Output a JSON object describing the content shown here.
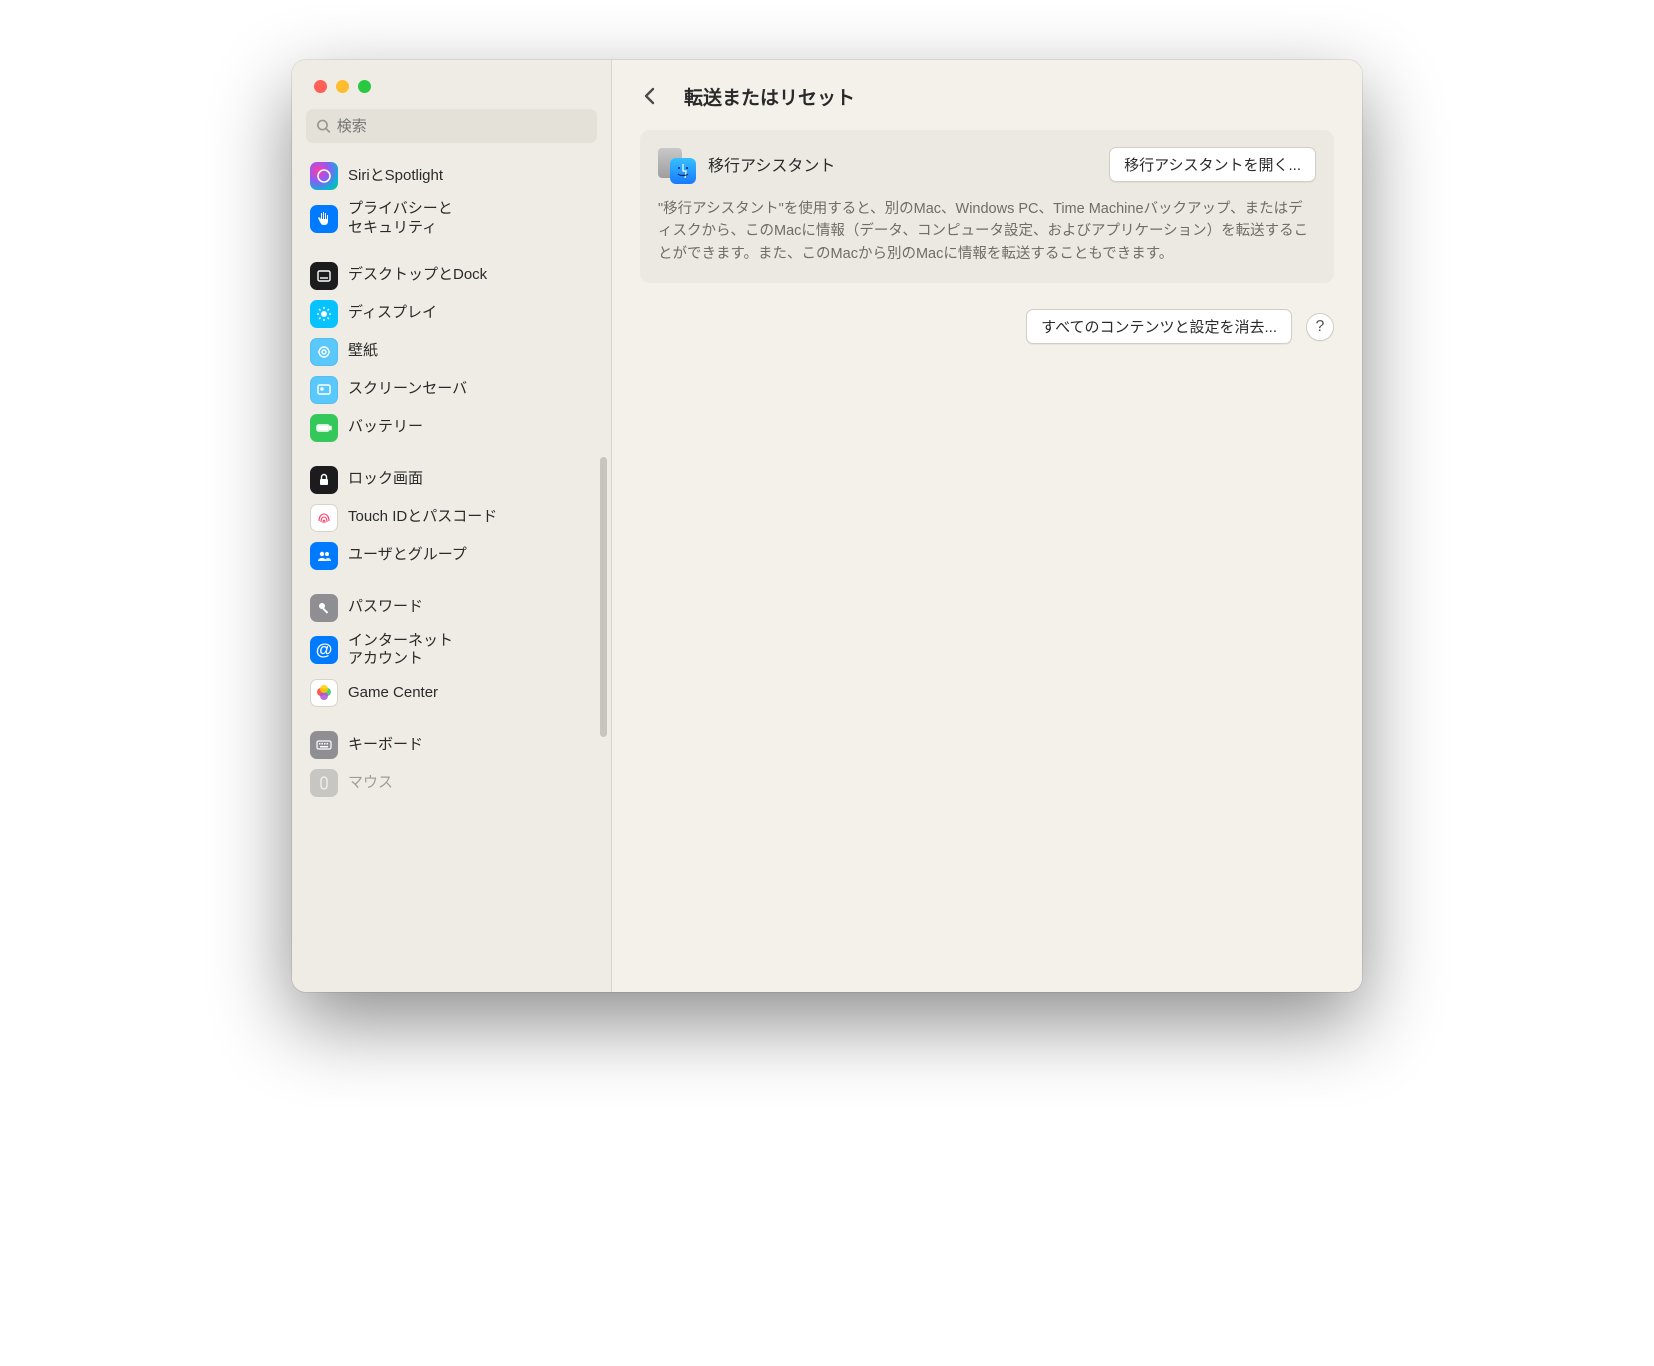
{
  "search": {
    "placeholder": "検索"
  },
  "page": {
    "title": "転送またはリセット",
    "migration": {
      "label": "移行アシスタント",
      "button": "移行アシスタントを開く...",
      "description": "\"移行アシスタント\"を使用すると、別のMac、Windows PC、Time Machineバックアップ、またはディスクから、このMacに情報（データ、コンピュータ設定、およびアプリケーション）を転送することができます。また、このMacから別のMacに情報を転送することもできます。"
    },
    "erase_button": "すべてのコンテンツと設定を消去..."
  },
  "sidebar": {
    "groups": [
      {
        "items": [
          {
            "id": "siri",
            "label": "SiriとSpotlight"
          },
          {
            "id": "privacy",
            "label": "プライバシーと\nセキュリティ"
          }
        ]
      },
      {
        "items": [
          {
            "id": "desktop",
            "label": "デスクトップとDock"
          },
          {
            "id": "display",
            "label": "ディスプレイ"
          },
          {
            "id": "wallpaper",
            "label": "壁紙"
          },
          {
            "id": "screensaver",
            "label": "スクリーンセーバ"
          },
          {
            "id": "battery",
            "label": "バッテリー"
          }
        ]
      },
      {
        "items": [
          {
            "id": "lock",
            "label": "ロック画面"
          },
          {
            "id": "touchid",
            "label": "Touch IDとパスコード"
          },
          {
            "id": "users",
            "label": "ユーザとグループ"
          }
        ]
      },
      {
        "items": [
          {
            "id": "passwords",
            "label": "パスワード"
          },
          {
            "id": "internet",
            "label": "インターネット\nアカウント"
          },
          {
            "id": "gamecenter",
            "label": "Game Center"
          }
        ]
      },
      {
        "items": [
          {
            "id": "keyboard",
            "label": "キーボード"
          },
          {
            "id": "mouse",
            "label": "マウス"
          }
        ]
      }
    ]
  }
}
